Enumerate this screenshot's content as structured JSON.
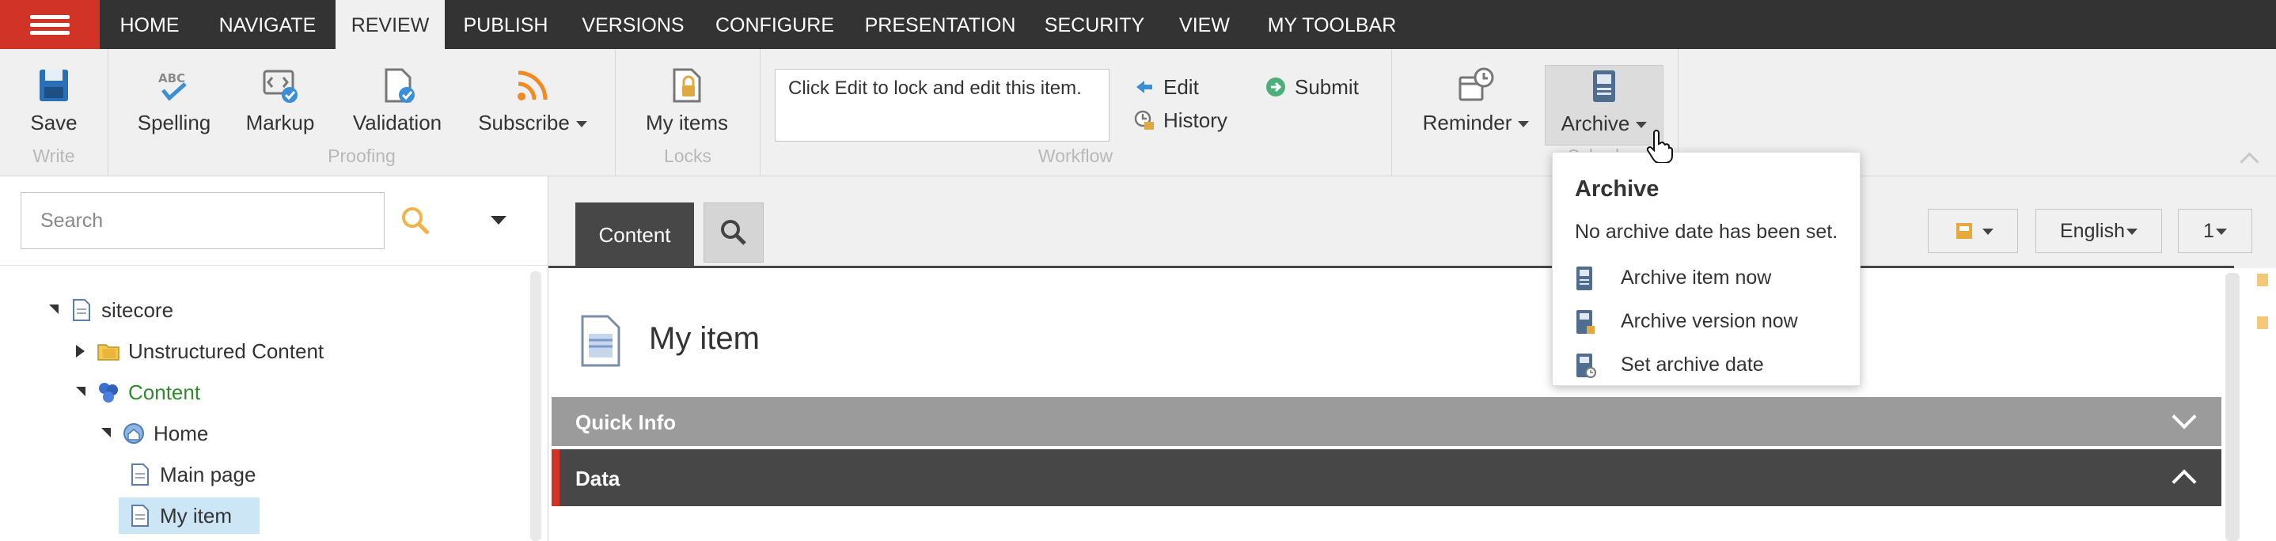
{
  "nav": {
    "tabs": [
      {
        "label": "HOME"
      },
      {
        "label": "NAVIGATE"
      },
      {
        "label": "REVIEW",
        "active": true
      },
      {
        "label": "PUBLISH"
      },
      {
        "label": "VERSIONS"
      },
      {
        "label": "CONFIGURE"
      },
      {
        "label": "PRESENTATION"
      },
      {
        "label": "SECURITY"
      },
      {
        "label": "VIEW"
      },
      {
        "label": "MY TOOLBAR"
      }
    ]
  },
  "ribbon": {
    "groups": {
      "write": "Write",
      "proofing": "Proofing",
      "locks": "Locks",
      "workflow": "Workflow",
      "schedule": "Schedu"
    },
    "buttons": {
      "save": "Save",
      "spelling": "Spelling",
      "markup": "Markup",
      "validation": "Validation",
      "subscribe": "Subscribe",
      "my_items": "My items",
      "edit": "Edit",
      "history": "History",
      "submit": "Submit",
      "reminder": "Reminder",
      "archive": "Archive"
    },
    "workflow_message": "Click Edit to lock and edit this item."
  },
  "search": {
    "placeholder": "Search"
  },
  "tree": {
    "items": [
      {
        "label": "sitecore",
        "icon": "document-icon"
      },
      {
        "label": "Unstructured Content",
        "icon": "folder-icon"
      },
      {
        "label": "Content",
        "icon": "content-cubes-icon"
      },
      {
        "label": "Home",
        "icon": "home-globe-icon"
      },
      {
        "label": "Main page",
        "icon": "document-icon"
      },
      {
        "label": "My item",
        "icon": "document-icon",
        "selected": true
      }
    ]
  },
  "content": {
    "tabs": {
      "content": "Content"
    },
    "language": "English",
    "version": "1",
    "item_title": "My item",
    "sections": {
      "quick_info": "Quick Info",
      "data": "Data"
    }
  },
  "archive_popup": {
    "title": "Archive",
    "description": "No archive date has been set.",
    "items": [
      {
        "label": "Archive item now"
      },
      {
        "label": "Archive version now"
      },
      {
        "label": "Set archive date"
      }
    ]
  },
  "colors": {
    "accent_red": "#d13327",
    "nav_bg": "#333333",
    "ribbon_bg": "#f0f0f0",
    "section_dark": "#474747",
    "content_green": "#2e8b2e"
  }
}
